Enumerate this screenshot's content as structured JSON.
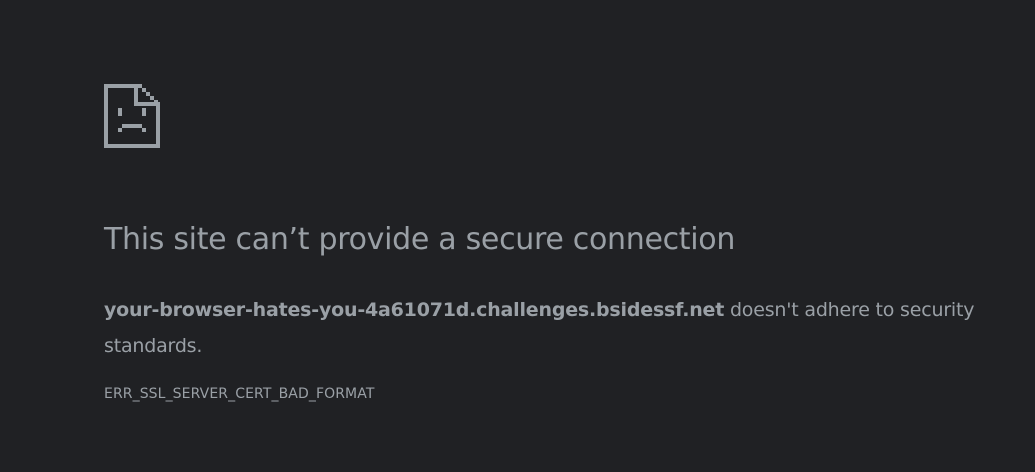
{
  "icon": "sad-page-icon",
  "colors": {
    "background": "#202124",
    "text": "#9aa0a6"
  },
  "error": {
    "heading": "This site can’t provide a secure connection",
    "host": "your-browser-hates-you-4a61071d.challenges.bsidessf.net",
    "message_suffix": " doesn't adhere to security standards.",
    "code": "ERR_SSL_SERVER_CERT_BAD_FORMAT"
  }
}
